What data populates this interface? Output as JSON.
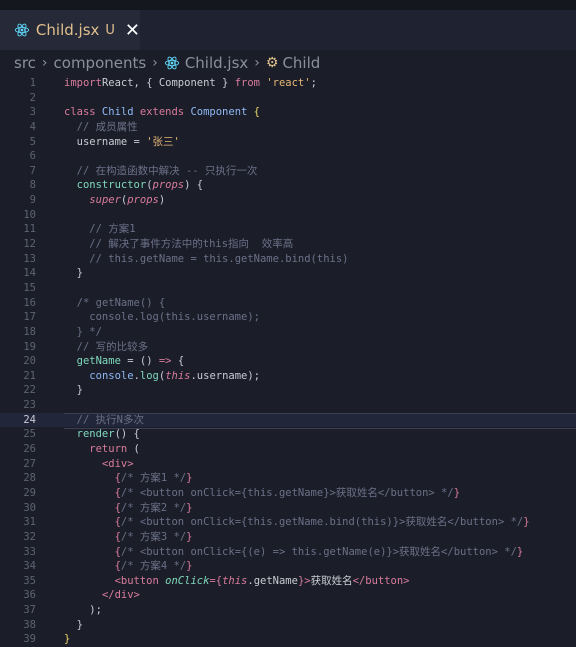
{
  "tab": {
    "filename": "Child.jsx",
    "status": "U"
  },
  "breadcrumb": {
    "root": "src",
    "folder": "components",
    "file": "Child.jsx",
    "symbol": "Child"
  },
  "colors": {
    "background": "#1b1e28",
    "tab_active": "#252938",
    "file_modified": "#e2c08d",
    "keyword": "#d97b9e",
    "class_name": "#8fb8f5",
    "function": "#7fd8be",
    "string": "#e7b876",
    "comment": "#6b7088"
  },
  "editor": {
    "active_line": 24,
    "lines": [
      {
        "n": "1",
        "segs": [
          [
            "kw",
            "import"
          ],
          [
            "",
            "React, { Component } "
          ],
          [
            "kw",
            "from"
          ],
          [
            "str",
            " 'react'"
          ],
          [
            "",
            ";"
          ]
        ]
      },
      {
        "n": "2",
        "segs": []
      },
      {
        "n": "3",
        "segs": [
          [
            "kw",
            "class"
          ],
          [
            "cls",
            " Child"
          ],
          [
            "kw",
            " extends"
          ],
          [
            "cls",
            " Component"
          ],
          [
            "brace-y",
            " {"
          ]
        ]
      },
      {
        "n": "4",
        "segs": [
          [
            "",
            "  "
          ],
          [
            "cm",
            "// 成员属性"
          ]
        ]
      },
      {
        "n": "5",
        "segs": [
          [
            "",
            "  username = "
          ],
          [
            "str",
            "'张三'"
          ]
        ]
      },
      {
        "n": "6",
        "segs": []
      },
      {
        "n": "7",
        "segs": [
          [
            "",
            "  "
          ],
          [
            "cm",
            "// 在构造函数中解决 -- 只执行一次"
          ]
        ]
      },
      {
        "n": "8",
        "segs": [
          [
            "fn",
            "  constructor"
          ],
          [
            "",
            "("
          ],
          [
            "kw it",
            "props"
          ],
          [
            "",
            ") {"
          ]
        ]
      },
      {
        "n": "9",
        "segs": [
          [
            "",
            "    "
          ],
          [
            "kw it",
            "super"
          ],
          [
            "",
            "("
          ],
          [
            "kw it",
            "props"
          ],
          [
            "",
            ")"
          ]
        ]
      },
      {
        "n": "10",
        "segs": []
      },
      {
        "n": "11",
        "segs": [
          [
            "",
            "    "
          ],
          [
            "cm",
            "// 方案1"
          ]
        ]
      },
      {
        "n": "12",
        "segs": [
          [
            "",
            "    "
          ],
          [
            "cm",
            "// 解决了事件方法中的this指向  效率高"
          ]
        ]
      },
      {
        "n": "13",
        "segs": [
          [
            "",
            "    "
          ],
          [
            "cm",
            "// this.getName = this.getName.bind(this)"
          ]
        ]
      },
      {
        "n": "14",
        "segs": [
          [
            "",
            "  }"
          ]
        ]
      },
      {
        "n": "15",
        "segs": []
      },
      {
        "n": "16",
        "segs": [
          [
            "",
            "  "
          ],
          [
            "cm",
            "/* getName() {"
          ]
        ]
      },
      {
        "n": "17",
        "segs": [
          [
            "cm",
            "    console.log(this.username);"
          ]
        ]
      },
      {
        "n": "18",
        "segs": [
          [
            "cm",
            "  } */"
          ]
        ]
      },
      {
        "n": "19",
        "segs": [
          [
            "",
            "  "
          ],
          [
            "cm",
            "// 写的比较多"
          ]
        ]
      },
      {
        "n": "20",
        "segs": [
          [
            "fn",
            "  getName"
          ],
          [
            "",
            " = () "
          ],
          [
            "kw",
            "=>"
          ],
          [
            "",
            " {"
          ]
        ]
      },
      {
        "n": "21",
        "segs": [
          [
            "",
            "    "
          ],
          [
            "cls",
            "console"
          ],
          [
            "",
            "."
          ],
          [
            "fn",
            "log"
          ],
          [
            "",
            "("
          ],
          [
            "kw it",
            "this"
          ],
          [
            "",
            ".username);"
          ]
        ]
      },
      {
        "n": "22",
        "segs": [
          [
            "",
            "  }"
          ]
        ]
      },
      {
        "n": "23",
        "segs": []
      },
      {
        "n": "24",
        "segs": [
          [
            "",
            "  "
          ],
          [
            "cm",
            "// 执行N多次"
          ]
        ]
      },
      {
        "n": "25",
        "segs": [
          [
            "fn",
            "  render"
          ],
          [
            "",
            "() {"
          ]
        ]
      },
      {
        "n": "26",
        "segs": [
          [
            "kw",
            "    return"
          ],
          [
            "",
            " ("
          ]
        ]
      },
      {
        "n": "27",
        "segs": [
          [
            "",
            "      "
          ],
          [
            "kw",
            "<div>"
          ]
        ]
      },
      {
        "n": "28",
        "segs": [
          [
            "",
            "        "
          ],
          [
            "kw",
            "{"
          ],
          [
            "cm",
            "/* 方案1 */"
          ],
          [
            "kw",
            "}"
          ]
        ]
      },
      {
        "n": "29",
        "segs": [
          [
            "",
            "        "
          ],
          [
            "kw",
            "{"
          ],
          [
            "cm",
            "/* <button onClick={this.getName}>获取姓名</button> */"
          ],
          [
            "kw",
            "}"
          ]
        ]
      },
      {
        "n": "30",
        "segs": [
          [
            "",
            "        "
          ],
          [
            "kw",
            "{"
          ],
          [
            "cm",
            "/* 方案2 */"
          ],
          [
            "kw",
            "}"
          ]
        ]
      },
      {
        "n": "31",
        "segs": [
          [
            "",
            "        "
          ],
          [
            "kw",
            "{"
          ],
          [
            "cm",
            "/* <button onClick={this.getName.bind(this)}>获取姓名</button> */"
          ],
          [
            "kw",
            "}"
          ]
        ]
      },
      {
        "n": "32",
        "segs": [
          [
            "",
            "        "
          ],
          [
            "kw",
            "{"
          ],
          [
            "cm",
            "/* 方案3 */"
          ],
          [
            "kw",
            "}"
          ]
        ]
      },
      {
        "n": "33",
        "segs": [
          [
            "",
            "        "
          ],
          [
            "kw",
            "{"
          ],
          [
            "cm",
            "/* <button onClick={(e) => this.getName(e)}>获取姓名</button> */"
          ],
          [
            "kw",
            "}"
          ]
        ]
      },
      {
        "n": "34",
        "segs": [
          [
            "",
            "        "
          ],
          [
            "kw",
            "{"
          ],
          [
            "cm",
            "/* 方案4 */"
          ],
          [
            "kw",
            "}"
          ]
        ]
      },
      {
        "n": "35",
        "segs": [
          [
            "",
            "        "
          ],
          [
            "kw",
            "<button"
          ],
          [
            "attr",
            " onClick"
          ],
          [
            "kw",
            "={"
          ],
          [
            "kw it",
            "this"
          ],
          [
            "",
            ".getName"
          ],
          [
            "kw",
            "}>"
          ],
          [
            "",
            "获取姓名"
          ],
          [
            "kw",
            "</button>"
          ]
        ]
      },
      {
        "n": "36",
        "segs": [
          [
            "",
            "      "
          ],
          [
            "kw",
            "</div>"
          ]
        ]
      },
      {
        "n": "37",
        "segs": [
          [
            "",
            "    );"
          ]
        ]
      },
      {
        "n": "38",
        "segs": [
          [
            "",
            "  }"
          ]
        ]
      },
      {
        "n": "39",
        "segs": [
          [
            "brace-y",
            "}"
          ]
        ]
      }
    ]
  }
}
